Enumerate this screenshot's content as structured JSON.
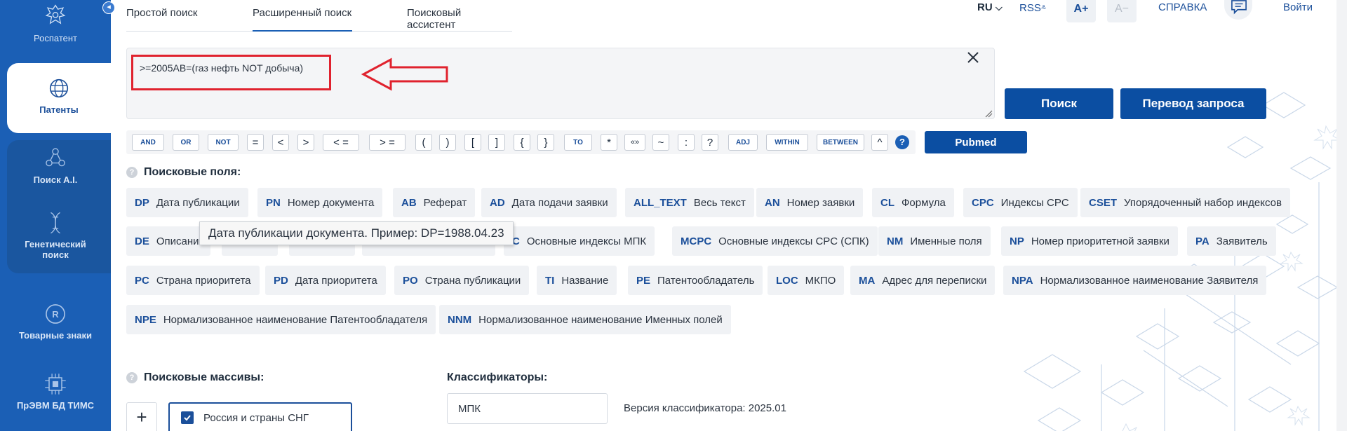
{
  "sidebar": {
    "brand": "Роспатент",
    "items": [
      {
        "label": "Патенты",
        "icon": "globe-icon"
      },
      {
        "label": "Поиск A.I.",
        "icon": "ai-nodes-icon"
      },
      {
        "label": "Генетический поиск",
        "icon": "dna-icon"
      },
      {
        "label": "Товарные знаки",
        "icon": "trademark-icon"
      },
      {
        "label": "ПрЭВМ БД ТИМС",
        "icon": "chip-icon"
      }
    ]
  },
  "tabs": [
    "Простой поиск",
    "Расширенный поиск",
    "Поисковый ассистент"
  ],
  "active_tab": "Расширенный поиск",
  "topbar": {
    "lang": "RU",
    "rss": "RSS",
    "font_larger": "A+",
    "font_smaller": "A−",
    "help": "СПРАВКА",
    "login": "Войти"
  },
  "query": {
    "value": ">=2005AB=(газ нефть NOT добыча)"
  },
  "buttons": {
    "search": "Поиск",
    "translate": "Перевод запроса",
    "pubmed": "Pubmed"
  },
  "operators": [
    "AND",
    "OR",
    "NOT",
    "=",
    "<",
    ">",
    "< =",
    "> =",
    "(",
    ")",
    "[",
    "]",
    "{",
    "}",
    "TO",
    "*",
    "«»",
    "~",
    ":",
    "?",
    "ADJ",
    "WITHIN",
    "BETWEEN",
    "^"
  ],
  "help_mark": "?",
  "fields_label": "Поисковые поля:",
  "fields": [
    {
      "code": "DP",
      "name": "Дата публикации"
    },
    {
      "code": "PN",
      "name": "Номер документа"
    },
    {
      "code": "AB",
      "name": "Реферат"
    },
    {
      "code": "AD",
      "name": "Дата подачи заявки"
    },
    {
      "code": "ALL_TEXT",
      "name": "Весь текст"
    },
    {
      "code": "AN",
      "name": "Номер заявки"
    },
    {
      "code": "CL",
      "name": "Формула"
    },
    {
      "code": "CPC",
      "name": "Индексы CPC"
    },
    {
      "code": "CSET",
      "name": "Упорядоченный набор индексов"
    },
    {
      "code": "DE",
      "name": "Описание"
    },
    {
      "code": "C",
      "name": "Основные индексы МПК"
    },
    {
      "code": "MCPC",
      "name": "Основные индексы CPC (СПК)"
    },
    {
      "code": "NM",
      "name": "Именные поля"
    },
    {
      "code": "NP",
      "name": "Номер приоритетной заявки"
    },
    {
      "code": "PA",
      "name": "Заявитель"
    },
    {
      "code": "PC",
      "name": "Страна приоритета"
    },
    {
      "code": "PD",
      "name": "Дата приоритета"
    },
    {
      "code": "PO",
      "name": "Страна публикации"
    },
    {
      "code": "TI",
      "name": "Название"
    },
    {
      "code": "PE",
      "name": "Патентообладатель"
    },
    {
      "code": "LOC",
      "name": "МКПО"
    },
    {
      "code": "MA",
      "name": "Адрес для переписки"
    },
    {
      "code": "NPA",
      "name": "Нормализованное наименование Заявителя"
    },
    {
      "code": "NPE",
      "name": "Нормализованное наименование Патентообладателя"
    },
    {
      "code": "NNM",
      "name": "Нормализованное наименование Именных полей"
    }
  ],
  "tooltip": "Дата публикации документа. Пример: DP=1988.04.23",
  "arrays_label": "Поисковые массивы:",
  "arrays": [
    {
      "label": "Россия и страны СНГ",
      "checked": true
    }
  ],
  "classifiers_label": "Классификаторы:",
  "classifier_select": "МПК",
  "classifier_version": "Версия классификатора: 2025.01",
  "colors": {
    "sidebar": "#1b5fb5",
    "primary": "#0b4ea2",
    "annotation": "#e0222e"
  }
}
